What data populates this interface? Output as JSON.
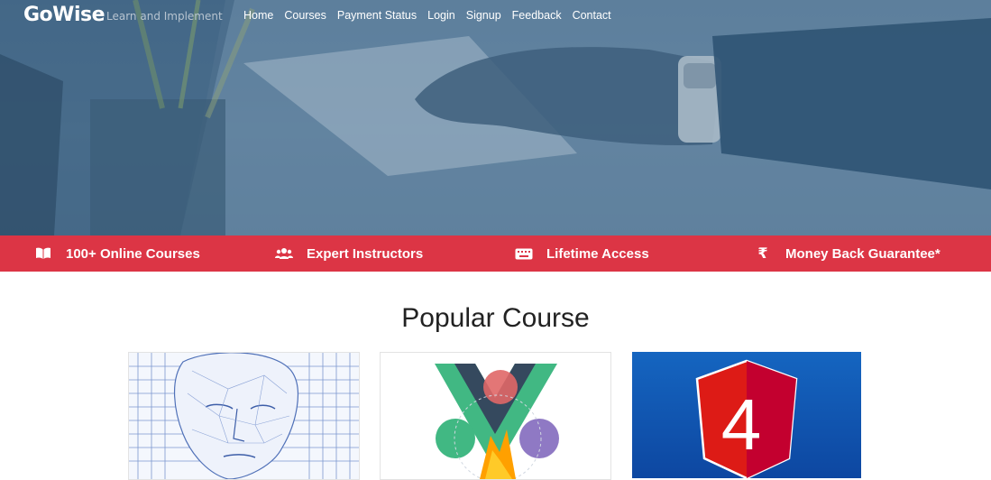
{
  "brand": {
    "name": "GoWise",
    "tagline": "Learn and Implement"
  },
  "nav": {
    "items": [
      "Home",
      "Courses",
      "Payment Status",
      "Login",
      "Signup",
      "Feedback",
      "Contact"
    ]
  },
  "features": [
    {
      "icon": "book-open-icon",
      "label": "100+ Online Courses"
    },
    {
      "icon": "users-icon",
      "label": "Expert Instructors"
    },
    {
      "icon": "keyboard-icon",
      "label": "Lifetime Access"
    },
    {
      "icon": "rupee-icon",
      "label": "Money Back Guarantee*"
    }
  ],
  "popular": {
    "title": "Popular Course",
    "cards": [
      {
        "image": "wireframe-face-image"
      },
      {
        "image": "vue-firebase-logo-image"
      },
      {
        "image": "angular-4-logo-image"
      }
    ]
  },
  "colors": {
    "hero_overlay": "#4f7391",
    "feature_bar": "#dc3545",
    "angular_bg": "#1565c0",
    "angular_red": "#dd1b16"
  }
}
